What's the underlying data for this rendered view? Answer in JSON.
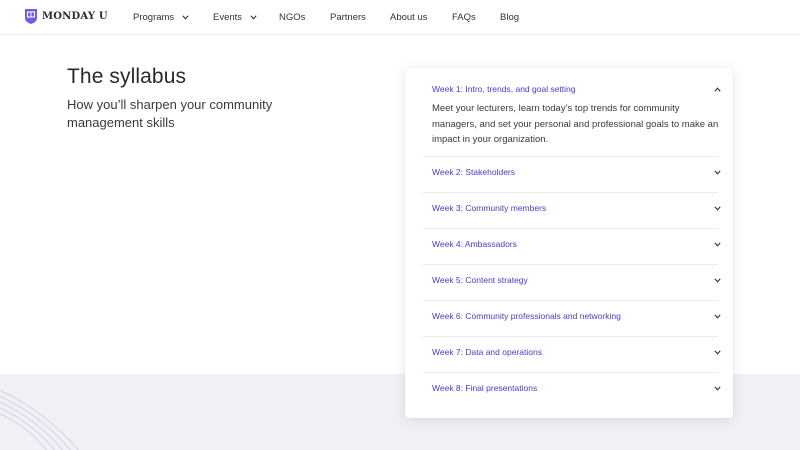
{
  "header": {
    "logo_text": "MONDAY U",
    "nav": [
      {
        "label": "Programs",
        "has_dropdown": true
      },
      {
        "label": "Events",
        "has_dropdown": true
      },
      {
        "label": "NGOs",
        "has_dropdown": false
      },
      {
        "label": "Partners",
        "has_dropdown": false
      },
      {
        "label": "About us",
        "has_dropdown": false
      },
      {
        "label": "FAQs",
        "has_dropdown": false
      },
      {
        "label": "Blog",
        "has_dropdown": false
      }
    ]
  },
  "intro": {
    "title": "The syllabus",
    "subtitle": "How you’ll sharpen your community management skills"
  },
  "syllabus": {
    "weeks": [
      {
        "title": "Week 1: Intro, trends, and goal setting",
        "expanded": true,
        "description": "Meet your lecturers, learn today’s top trends for community managers, and set your personal and professional goals to make an impact in your organization."
      },
      {
        "title": "Week 2: Stakeholders",
        "expanded": false
      },
      {
        "title": "Week 3: Community members",
        "expanded": false
      },
      {
        "title": "Week 4: Ambassadors",
        "expanded": false
      },
      {
        "title": "Week 5: Content strategy",
        "expanded": false
      },
      {
        "title": "Week 6: Community professionals and networking",
        "expanded": false
      },
      {
        "title": "Week 7: Data and operations",
        "expanded": false
      },
      {
        "title": "Week 8: Final presentations",
        "expanded": false
      }
    ]
  },
  "colors": {
    "accent": "#5534d6",
    "logo": "#6c5ce7",
    "band": "#f0f0f5"
  }
}
